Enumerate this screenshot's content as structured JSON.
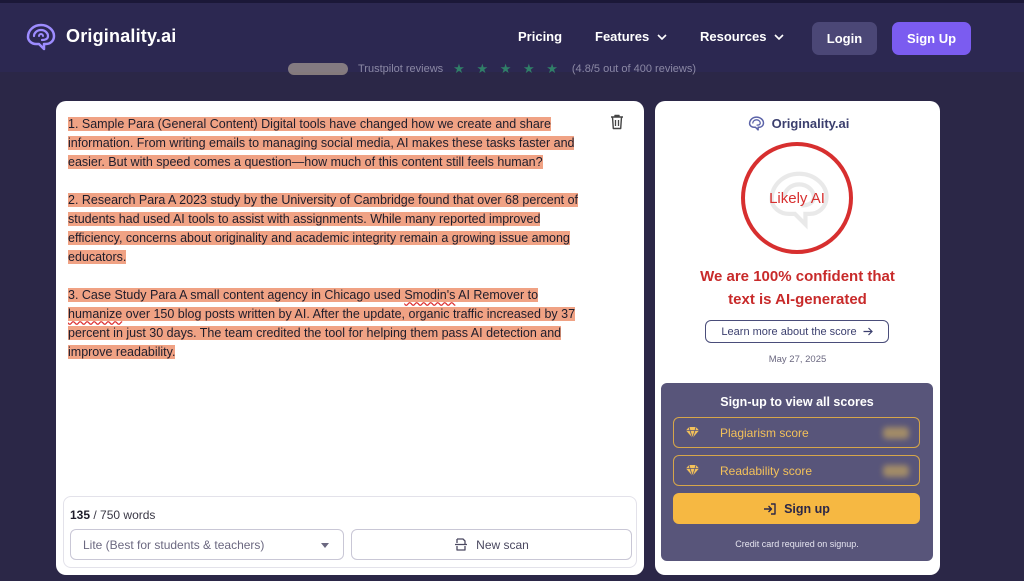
{
  "nav": {
    "brand": "Originality.ai",
    "links": [
      "Pricing",
      "Features",
      "Resources"
    ],
    "login": "Login",
    "signup": "Sign Up"
  },
  "trust": {
    "text": "Trustpilot reviews",
    "rating_text": "(4.8/5 out of 400 reviews)",
    "stars": "★ ★ ★ ★ ★"
  },
  "editor": {
    "paragraphs": [
      {
        "parts": [
          "1. Sample Para (General Content) Digital tools have changed how we create and share information. From writing emails to managing social media, AI makes these tasks faster and easier. But with speed comes a question—how much of this content still feels human?"
        ]
      },
      {
        "parts": [
          "2. Research Para A 2023 study by the University of Cambridge found that over 68 percent of students had used AI tools to assist with assignments. While many reported improved efficiency, concerns about originality and academic integrity remain a growing issue among educators."
        ]
      },
      {
        "parts": [
          "3. Case Study Para A small content agency in Chicago used ",
          "Smodin's",
          " AI Remover to ",
          "humanize",
          " over 150 blog posts written by AI. After the update, organic traffic increased by 37 percent in just 30 days. The team credited the tool for helping them pass AI detection and improve readability."
        ]
      }
    ],
    "word_count": "135",
    "word_limit": "/ 750 words",
    "model": "Lite (Best for students & teachers)",
    "new_scan": "New scan"
  },
  "result": {
    "brand": "Originality.ai",
    "score_label": "Likely AI",
    "confidence_line1": "We are 100% confident that",
    "confidence_line2": "text is AI-generated",
    "learn_more": "Learn more about the score",
    "date": "May 27, 2025",
    "upsell": {
      "title": "Sign-up to view all scores",
      "rows": [
        "Plagiarism score",
        "Readability score"
      ],
      "signup": "Sign up",
      "note": "Credit card required on signup."
    }
  },
  "colors": {
    "highlight": "#f0a284",
    "ai_red": "#d72f2f",
    "accent_purple": "#7b5cf0",
    "gold": "#f6b842"
  }
}
